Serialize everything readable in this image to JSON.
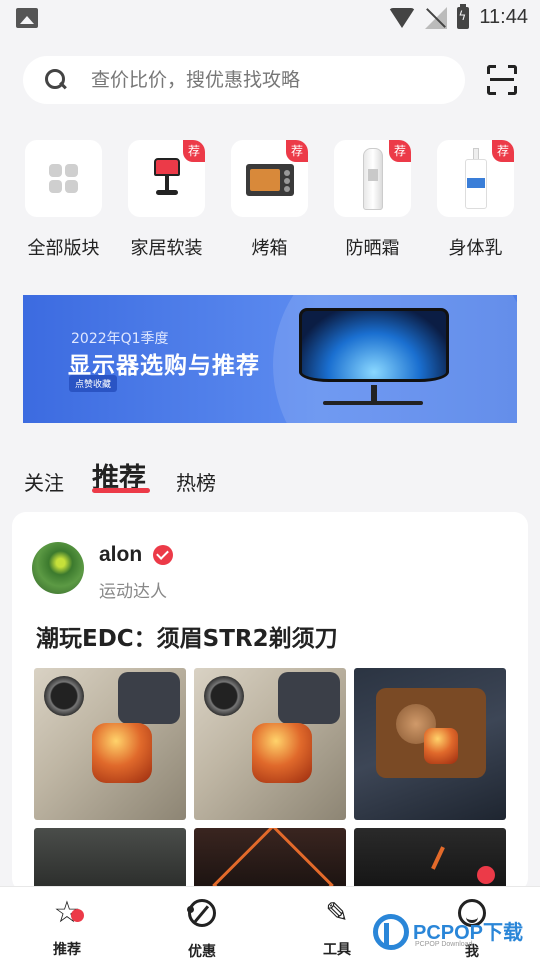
{
  "status_bar": {
    "time": "11:44"
  },
  "search": {
    "placeholder": "查价比价，搜优惠找攻略"
  },
  "categories": [
    {
      "label": "全部版块",
      "icon": "grid-icon"
    },
    {
      "label": "家居软装",
      "icon": "lamp-icon",
      "badge": "荐"
    },
    {
      "label": "烤箱",
      "icon": "oven-icon",
      "badge": "荐"
    },
    {
      "label": "防晒霜",
      "icon": "sunscreen-tube-icon",
      "badge": "荐"
    },
    {
      "label": "身体乳",
      "icon": "lotion-bottle-icon",
      "badge": "荐"
    }
  ],
  "banner": {
    "subtitle": "2022年Q1季度",
    "title": "显示器选购与推荐",
    "tag": "点赞收藏"
  },
  "tabs": [
    {
      "label": "关注",
      "active": false
    },
    {
      "label": "推荐",
      "active": true
    },
    {
      "label": "热榜",
      "active": false
    }
  ],
  "feed": {
    "post": {
      "username": "alon",
      "user_title": "运动达人",
      "title": "潮玩EDC：须眉STR2剃须刀"
    }
  },
  "bottom_nav": [
    {
      "label": "推荐",
      "icon": "star-icon"
    },
    {
      "label": "优惠",
      "icon": "deal-icon"
    },
    {
      "label": "工具",
      "icon": "wrench-icon"
    },
    {
      "label": "我",
      "icon": "profile-icon"
    }
  ],
  "watermark": {
    "text": "PCPOP下载",
    "sub": "PCPOP Download"
  },
  "colors": {
    "accent": "#ec3a48",
    "background": "#f4f4f6",
    "banner": "#4f7fe8"
  }
}
